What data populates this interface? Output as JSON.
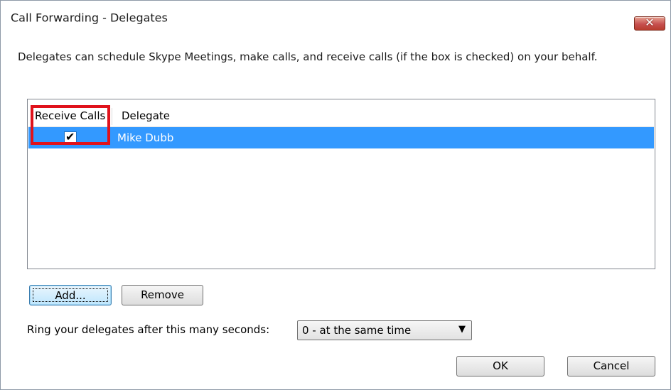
{
  "window": {
    "title": "Call Forwarding - Delegates",
    "close_glyph": "✕"
  },
  "description": "Delegates can schedule Skype Meetings, make calls, and receive calls (if the box is checked) on your behalf.",
  "delegate_list": {
    "columns": [
      "Receive Calls",
      "Delegate"
    ],
    "rows": [
      {
        "receive_calls": true,
        "check_glyph": "✔",
        "name": "Mike Dubb",
        "selected": true
      }
    ]
  },
  "buttons": {
    "add_label": "Add...",
    "remove_label": "Remove",
    "ok_label": "OK",
    "cancel_label": "Cancel"
  },
  "ring": {
    "label": "Ring your delegates after this many seconds:",
    "selected": "0 - at the same time",
    "arrow_glyph": "▼"
  },
  "colors": {
    "selection": "#3399ff",
    "highlight": "#e0121b",
    "close_button": "#c75050"
  }
}
